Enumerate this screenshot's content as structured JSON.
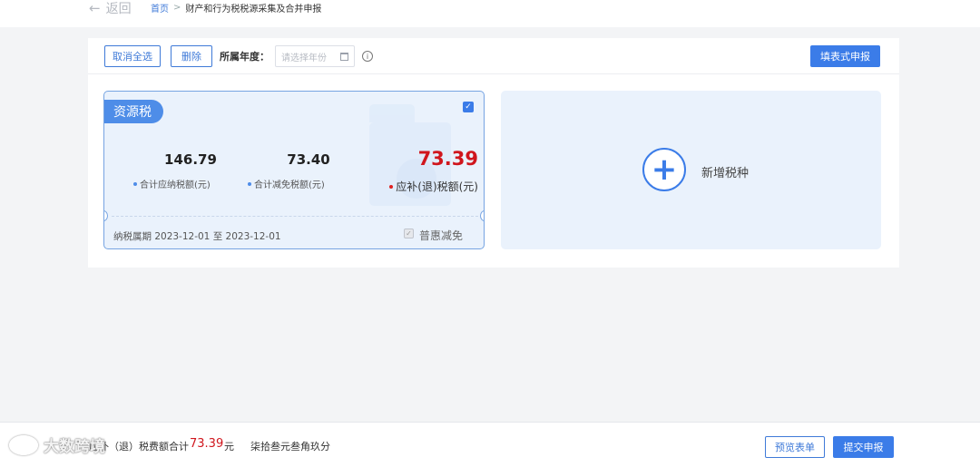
{
  "nav": {
    "back_label": "返回",
    "breadcrumb_home": "首页",
    "breadcrumb_sep": ">",
    "breadcrumb_current": "财产和行为税税源采集及合并申报"
  },
  "toolbar": {
    "deselect_all": "取消全选",
    "delete": "删除",
    "year_label": "所属年度：",
    "year_placeholder": "请选择年份",
    "fill_form_declare": "填表式申报"
  },
  "tax_card": {
    "tag": "资源税",
    "total_payable": "146.79",
    "total_payable_label": "合计应纳税额(元)",
    "total_reduction": "73.40",
    "total_reduction_label": "合计减免税额(元)",
    "refund_amount": "73.39",
    "refund_label": "应补(退)税额(元)",
    "period_text": "纳税属期 2023-12-01 至 2023-12-01",
    "benefit_label": "普惠减免",
    "checked": true
  },
  "add_card": {
    "label": "新增税种"
  },
  "footer": {
    "total_label": "应补（退）税费额合计",
    "total_value": "73.39",
    "unit": "元",
    "amount_words": "柒拾叁元叁角玖分",
    "preview_button": "预览表单",
    "submit_button": "提交申报",
    "watermark_text": "大数跨境"
  },
  "colors": {
    "primary": "#3b7ce8",
    "danger": "#d0161d",
    "card_bg": "#eaf2fc"
  }
}
